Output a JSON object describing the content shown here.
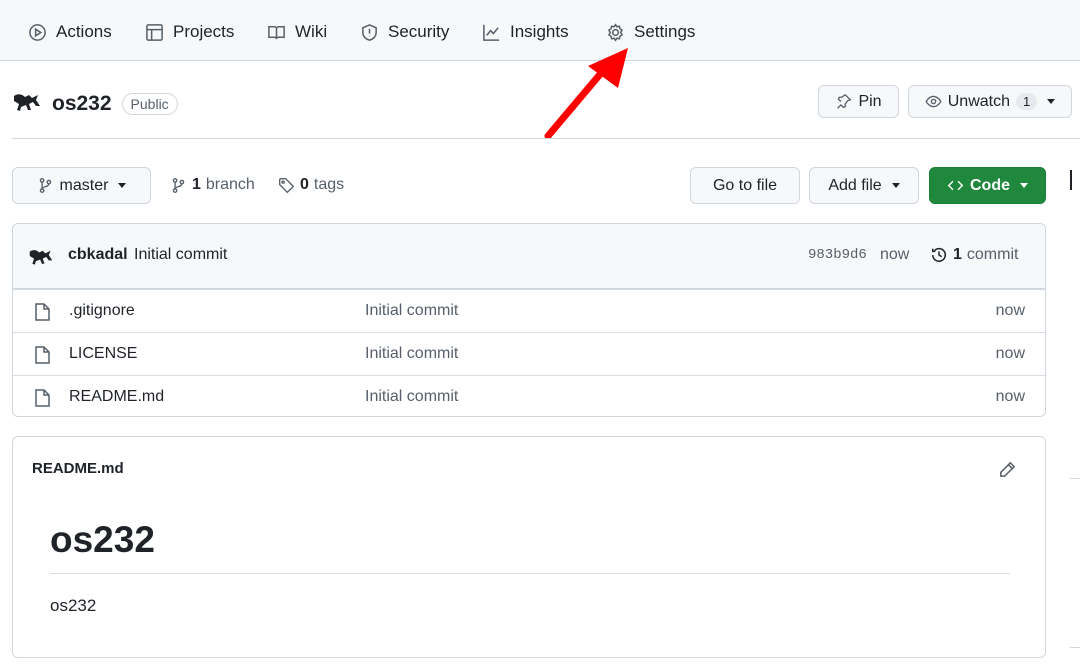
{
  "tabs": [
    {
      "label": "Actions",
      "icon": "play-circle-icon"
    },
    {
      "label": "Projects",
      "icon": "table-icon"
    },
    {
      "label": "Wiki",
      "icon": "book-icon"
    },
    {
      "label": "Security",
      "icon": "shield-icon"
    },
    {
      "label": "Insights",
      "icon": "graph-icon"
    },
    {
      "label": "Settings",
      "icon": "gear-icon"
    }
  ],
  "repo": {
    "name": "os232",
    "visibility": "Public"
  },
  "header_actions": {
    "pin_label": "Pin",
    "unwatch_label": "Unwatch",
    "watch_count": "1"
  },
  "branch_bar": {
    "branch": "master",
    "branch_count": "1",
    "branch_word": "branch",
    "tag_count": "0",
    "tag_word": "tags",
    "go_to_file": "Go to file",
    "add_file": "Add file",
    "code": "Code"
  },
  "latest_commit": {
    "author": "cbkadal",
    "message": "Initial commit",
    "sha": "983b9d6",
    "age": "now",
    "commit_count": "1",
    "commit_word": "commit"
  },
  "files": [
    {
      "name": ".gitignore",
      "message": "Initial commit",
      "age": "now"
    },
    {
      "name": "LICENSE",
      "message": "Initial commit",
      "age": "now"
    },
    {
      "name": "README.md",
      "message": "Initial commit",
      "age": "now"
    }
  ],
  "readme": {
    "filename": "README.md",
    "heading": "os232",
    "body": "os232"
  },
  "colors": {
    "accent_green": "#1f883d",
    "annotation_arrow": "#ff0000"
  }
}
